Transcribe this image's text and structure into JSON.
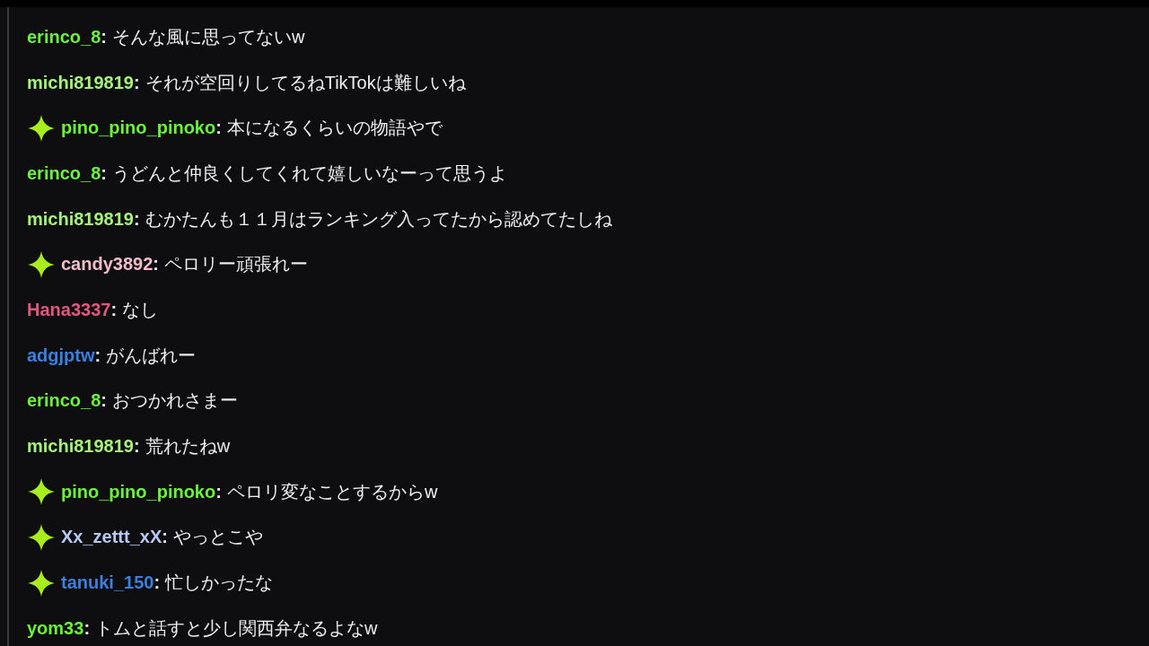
{
  "messages": [
    {
      "user": "erinco_8",
      "sep": ":",
      "color": "#6cf23c",
      "badge": false,
      "text": "そんな風に思ってないw"
    },
    {
      "user": "michi819819",
      "sep": ":",
      "color": "#a6f27c",
      "badge": false,
      "text": "それが空回りしてるねTikTokは難しいね"
    },
    {
      "user": "pino_pino_pinoko",
      "sep": ":",
      "color": "#6cf23c",
      "badge": true,
      "text": "本になるくらいの物語やで"
    },
    {
      "user": "erinco_8",
      "sep": ":",
      "color": "#6cf23c",
      "badge": false,
      "text": "うどんと仲良くしてくれて嬉しいなーって思うよ"
    },
    {
      "user": "michi819819",
      "sep": ":",
      "color": "#a6f27c",
      "badge": false,
      "text": "むかたんも１１月はランキング入ってたから認めてたしね"
    },
    {
      "user": "candy3892",
      "sep": ":",
      "color": "#f2bccb",
      "badge": true,
      "text": "ペロリー頑張れー"
    },
    {
      "user": "Hana3337",
      "sep": ":",
      "color": "#e2577f",
      "badge": false,
      "text": "なし"
    },
    {
      "user": "adgjptw",
      "sep": ":",
      "color": "#3b7fe0",
      "badge": false,
      "text": "がんばれー"
    },
    {
      "user": "erinco_8",
      "sep": ":",
      "color": "#6cf23c",
      "badge": false,
      "text": "おつかれさまー"
    },
    {
      "user": "michi819819",
      "sep": ":",
      "color": "#a6f27c",
      "badge": false,
      "text": "荒れたねw"
    },
    {
      "user": "pino_pino_pinoko",
      "sep": ":",
      "color": "#6cf23c",
      "badge": true,
      "text": "ペロリ変なことするからw"
    },
    {
      "user": "Xx_zettt_xX",
      "sep": ":",
      "color": "#b4caf2",
      "badge": true,
      "text": "やっとこや"
    },
    {
      "user": "tanuki_150",
      "sep": ":",
      "color": "#3b7fe0",
      "badge": true,
      "text": "忙しかったな"
    },
    {
      "user": "yom33",
      "sep": ":",
      "color": "#6cf23c",
      "badge": false,
      "text": "トムと話すと少し関西弁なるよなw"
    }
  ]
}
